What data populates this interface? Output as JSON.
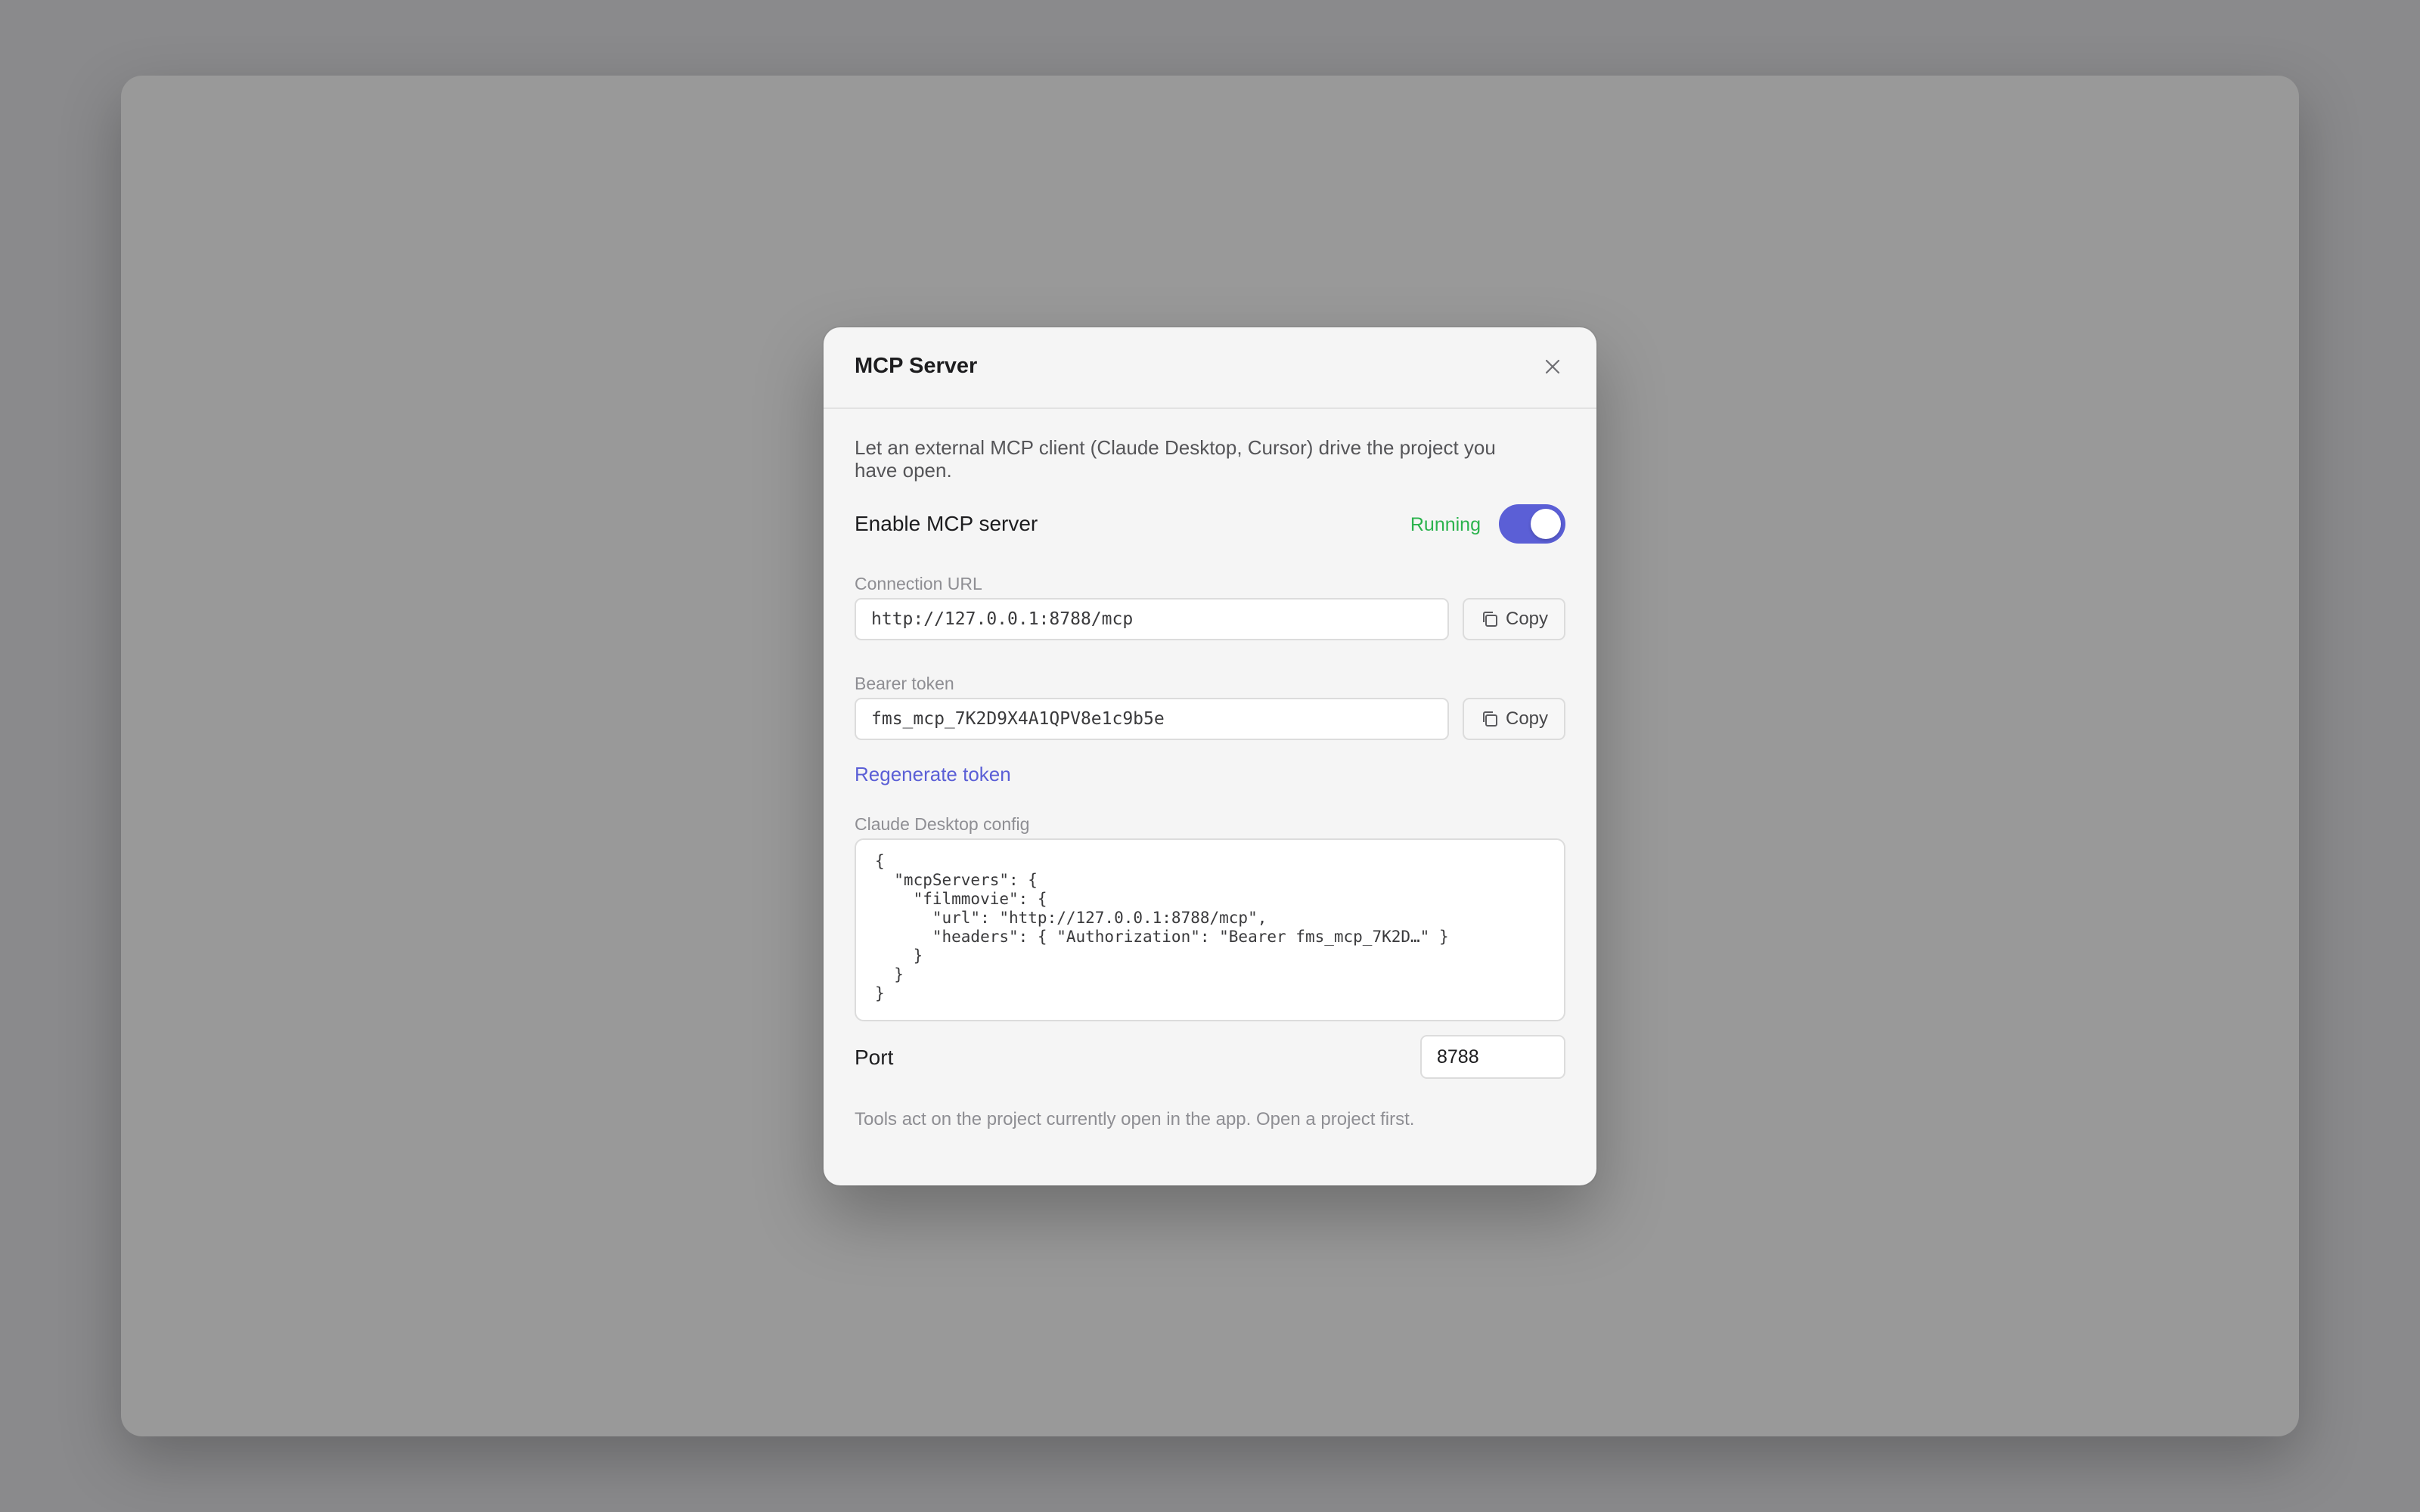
{
  "dialog": {
    "title": "MCP Server",
    "description": "Let an external MCP client (Claude Desktop, Cursor) drive the project you have open.",
    "enable": {
      "label": "Enable MCP server",
      "status": "Running",
      "enabled": true
    },
    "connection_url": {
      "label": "Connection URL",
      "value": "http://127.0.0.1:8788/mcp",
      "copy_label": "Copy"
    },
    "bearer_token": {
      "label": "Bearer token",
      "value": "fms_mcp_7K2D9X4A1QPV8e1c9b5e",
      "copy_label": "Copy",
      "regenerate_label": "Regenerate token"
    },
    "claude_config": {
      "label": "Claude Desktop config",
      "code": "{\n  \"mcpServers\": {\n    \"filmmovie\": {\n      \"url\": \"http://127.0.0.1:8788/mcp\",\n      \"headers\": { \"Authorization\": \"Bearer fms_mcp_7K2D…\" }\n    }\n  }\n}"
    },
    "port": {
      "label": "Port",
      "value": "8788"
    },
    "footer_note": "Tools act on the project currently open in the app. Open a project first."
  },
  "colors": {
    "accent": "#5b5fd6",
    "status_running": "#2bb34d",
    "backdrop": "#8a8a8c",
    "modal_bg": "#f5f5f5"
  },
  "icons": {
    "close": "close-icon",
    "copy": "copy-icon"
  }
}
